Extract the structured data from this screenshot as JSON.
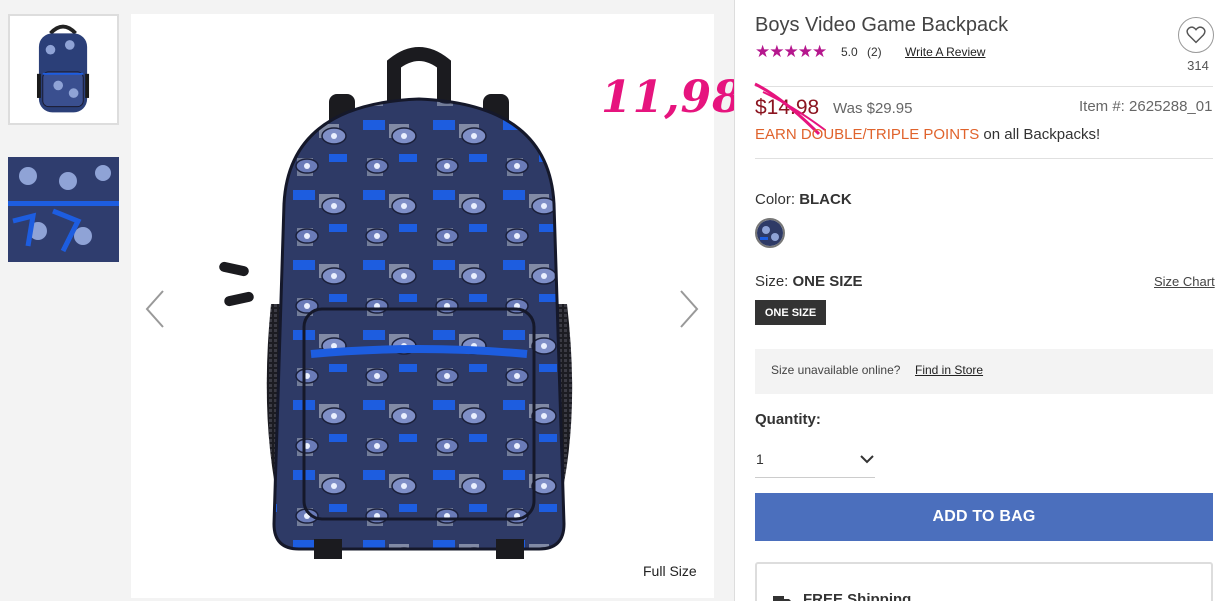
{
  "product": {
    "title": "Boys Video Game Backpack",
    "stars": "★★★★★",
    "rating": "5.0",
    "review_count": "(2)",
    "write_review": "Write A Review",
    "favorite_count": "314",
    "price": "$14.98",
    "was_price": "Was $29.95",
    "item_number": "Item #: 2625288_01",
    "promo_highlight": "EARN DOUBLE/TRIPLE POINTS",
    "promo_rest": " on all Backpacks!"
  },
  "annotation": {
    "handwritten_price": "11,98",
    "color": "#e6147e"
  },
  "gallery": {
    "full_size": "Full Size"
  },
  "options": {
    "color_label": "Color: ",
    "color_value": "BLACK",
    "size_label": "Size: ",
    "size_value": "ONE SIZE",
    "size_chart": "Size Chart",
    "size_button": "ONE SIZE",
    "size_unavailable": "Size unavailable online?",
    "find_in_store": "Find in Store",
    "quantity_label": "Quantity:",
    "quantity_value": "1"
  },
  "actions": {
    "add_to_bag": "ADD TO BAG",
    "free_shipping": "FREE Shipping"
  },
  "colors": {
    "accent_blue": "#4b6fbd",
    "price_red": "#8b1420",
    "promo_orange": "#e0632c",
    "star_magenta": "#b5178d"
  }
}
